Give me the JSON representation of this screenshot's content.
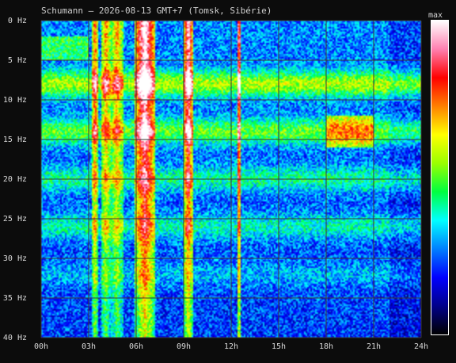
{
  "chart_data": {
    "type": "heatmap",
    "title": "Schumann – 2026-08-13 GMT+7  (Tomsk, Sibérie)",
    "x_ticks": [
      "00h",
      "03h",
      "06h",
      "09h",
      "12h",
      "15h",
      "18h",
      "21h",
      "24h"
    ],
    "y_ticks": [
      "0 Hz",
      "5 Hz",
      "10 Hz",
      "15 Hz",
      "20 Hz",
      "25 Hz",
      "30 Hz",
      "35 Hz",
      "40 Hz"
    ],
    "x_range_hours": [
      0,
      24
    ],
    "y_range_hz": [
      0,
      40
    ],
    "y_inverted": true,
    "grid": true,
    "colorbar": {
      "label": "max",
      "colors": [
        "#000000",
        "#00008a",
        "#0000ff",
        "#0080ff",
        "#00ffff",
        "#00ff40",
        "#9aff00",
        "#ffff00",
        "#ff8000",
        "#ff0000",
        "#ff80b0",
        "#ffffff"
      ]
    },
    "resonance_bands_hz": [
      {
        "center": 8,
        "intensity": 0.55
      },
      {
        "center": 14,
        "intensity": 0.45
      },
      {
        "center": 20,
        "intensity": 0.3
      },
      {
        "center": 26,
        "intensity": 0.28
      },
      {
        "center": 32,
        "intensity": 0.15
      }
    ],
    "disturbance_columns": [
      {
        "start_h": 3.2,
        "end_h": 3.6,
        "peak": 0.7
      },
      {
        "start_h": 3.8,
        "end_h": 4.4,
        "peak": 0.6
      },
      {
        "start_h": 4.4,
        "end_h": 5.2,
        "peak": 0.55
      },
      {
        "start_h": 5.9,
        "end_h": 7.2,
        "peak": 1.0
      },
      {
        "start_h": 9.0,
        "end_h": 9.6,
        "peak": 0.95
      },
      {
        "start_h": 12.4,
        "end_h": 12.6,
        "peak": 1.0
      }
    ],
    "hot_regions": [
      {
        "start_h": 18.0,
        "end_h": 21.0,
        "f_low": 12,
        "f_high": 16,
        "level": 0.5
      },
      {
        "start_h": 0.0,
        "end_h": 3.0,
        "f_low": 2,
        "f_high": 5,
        "level": 0.35
      }
    ]
  }
}
